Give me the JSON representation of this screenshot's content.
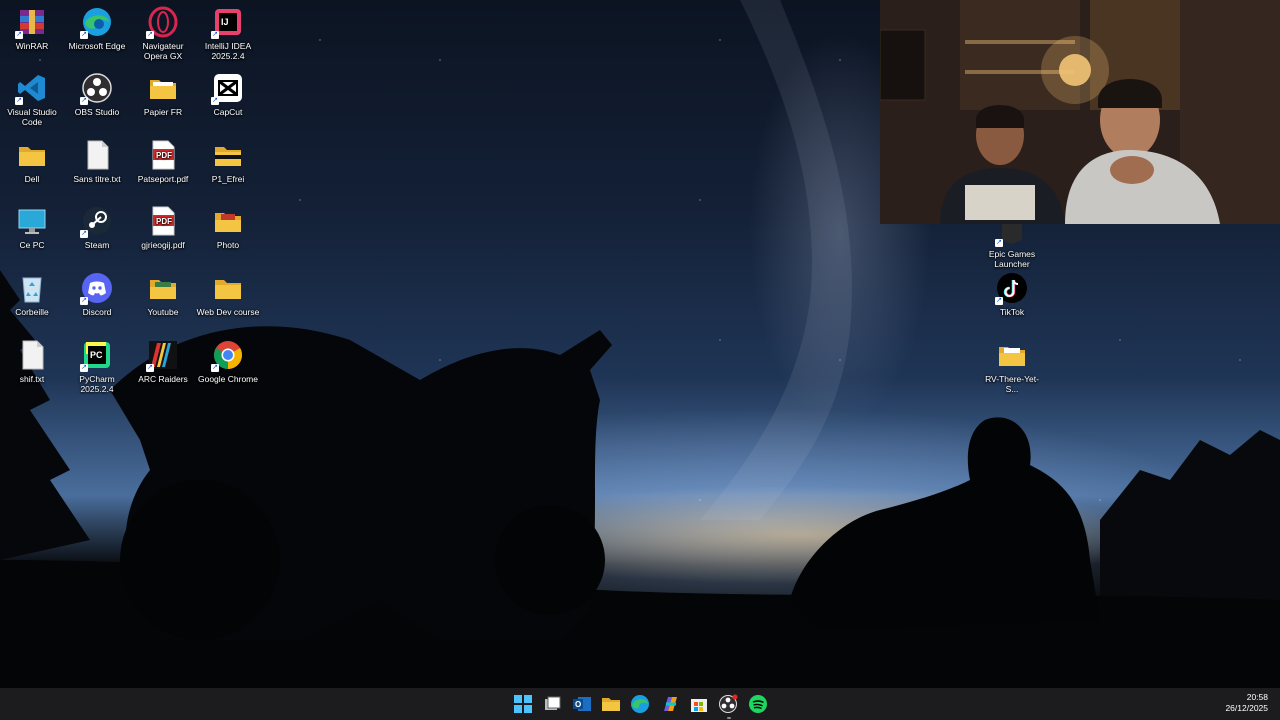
{
  "desktop_icons": [
    {
      "label": "WinRAR",
      "icon": "winrar-icon"
    },
    {
      "label": "Microsoft Edge",
      "icon": "edge-icon"
    },
    {
      "label": "Navigateur Opera GX",
      "icon": "opera-gx-icon"
    },
    {
      "label": "IntelliJ IDEA 2025.2.4",
      "icon": "intellij-icon"
    },
    {
      "label": "Visual Studio Code",
      "icon": "vscode-icon"
    },
    {
      "label": "OBS Studio",
      "icon": "obs-icon"
    },
    {
      "label": "Papier FR",
      "icon": "folder-icon"
    },
    {
      "label": "CapCut",
      "icon": "capcut-icon"
    },
    {
      "label": "Dell",
      "icon": "folder-icon"
    },
    {
      "label": "Sans titre.txt",
      "icon": "text-file-icon"
    },
    {
      "label": "Patseport.pdf",
      "icon": "pdf-icon"
    },
    {
      "label": "P1_Efrei",
      "icon": "folder-icon"
    },
    {
      "label": "Ce PC",
      "icon": "computer-icon"
    },
    {
      "label": "Steam",
      "icon": "steam-icon"
    },
    {
      "label": "gjrieogij.pdf",
      "icon": "pdf-icon"
    },
    {
      "label": "Photo",
      "icon": "folder-icon"
    },
    {
      "label": "Corbeille",
      "icon": "recycle-bin-icon"
    },
    {
      "label": "Discord",
      "icon": "discord-icon"
    },
    {
      "label": "Youtube",
      "icon": "folder-icon"
    },
    {
      "label": "Web Dev course",
      "icon": "folder-icon"
    },
    {
      "label": "shif.txt",
      "icon": "text-file-icon"
    },
    {
      "label": "PyCharm 2025.2.4",
      "icon": "pycharm-icon"
    },
    {
      "label": "ARC Raiders",
      "icon": "arc-raiders-icon"
    },
    {
      "label": "Google Chrome",
      "icon": "chrome-icon"
    }
  ],
  "right_icons": [
    {
      "label": "Epic Games Launcher",
      "icon": "epic-games-icon"
    },
    {
      "label": "TikTok",
      "icon": "tiktok-icon"
    },
    {
      "label": "RV-There-Yet-S...",
      "icon": "folder-icon"
    }
  ],
  "taskbar": {
    "apps": [
      "start-icon",
      "task-view-icon",
      "outlook-icon",
      "file-explorer-icon",
      "edge-icon",
      "copilot-icon",
      "store-icon",
      "obs-icon",
      "spotify-icon"
    ]
  },
  "clock": {
    "time": "20:58",
    "date": "26/12/2025"
  },
  "colors": {
    "taskbar": "#1c1c1e",
    "folder": "#f4c542",
    "accent": "#0078d4"
  }
}
